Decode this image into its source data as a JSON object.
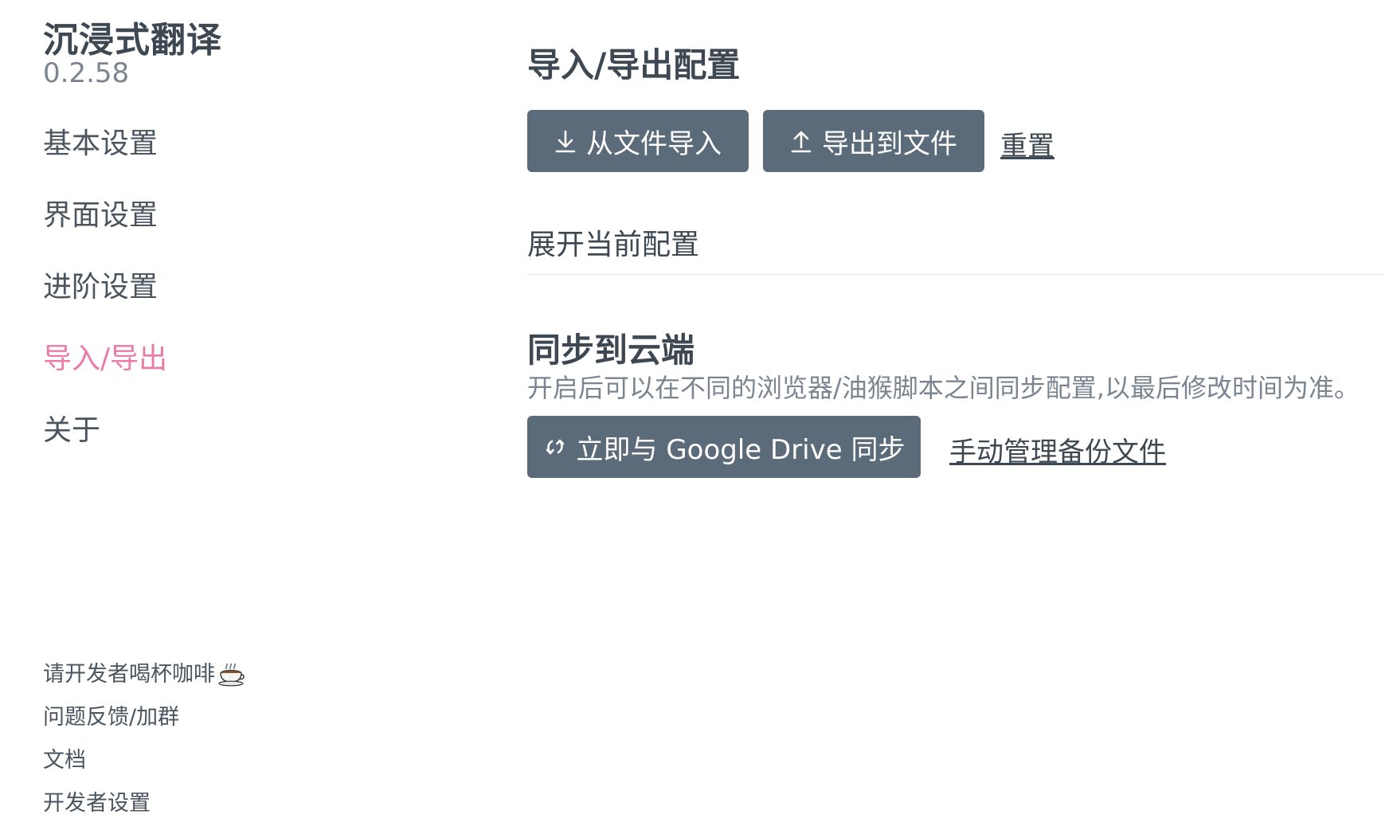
{
  "app": {
    "title": "沉浸式翻译",
    "version": "0.2.58"
  },
  "sidebar": {
    "items": [
      {
        "label": "基本设置",
        "active": false
      },
      {
        "label": "界面设置",
        "active": false
      },
      {
        "label": "进阶设置",
        "active": false
      },
      {
        "label": "导入/导出",
        "active": true
      },
      {
        "label": "关于",
        "active": false
      }
    ],
    "footer": {
      "coffee": "请开发者喝杯咖啡",
      "coffee_icon": "coffee-cup-icon",
      "feedback": "问题反馈/加群",
      "docs": "文档",
      "dev_settings": "开发者设置"
    }
  },
  "main": {
    "import_export": {
      "title": "导入/导出配置",
      "import_button": "从文件导入",
      "import_icon": "download-icon",
      "export_button": "导出到文件",
      "export_icon": "upload-icon",
      "reset_link": "重置",
      "expand_config": "展开当前配置"
    },
    "sync": {
      "title": "同步到云端",
      "description": "开启后可以在不同的浏览器/油猴脚本之间同步配置,以最后修改时间为准。",
      "sync_button": "立即与 Google Drive 同步",
      "sync_icon": "sync-icon",
      "manage_link": "手动管理备份文件"
    }
  },
  "colors": {
    "accent": "#ea7ba6",
    "button_bg": "#5b6b7a",
    "text": "#3d4852",
    "muted": "#7b8591"
  }
}
